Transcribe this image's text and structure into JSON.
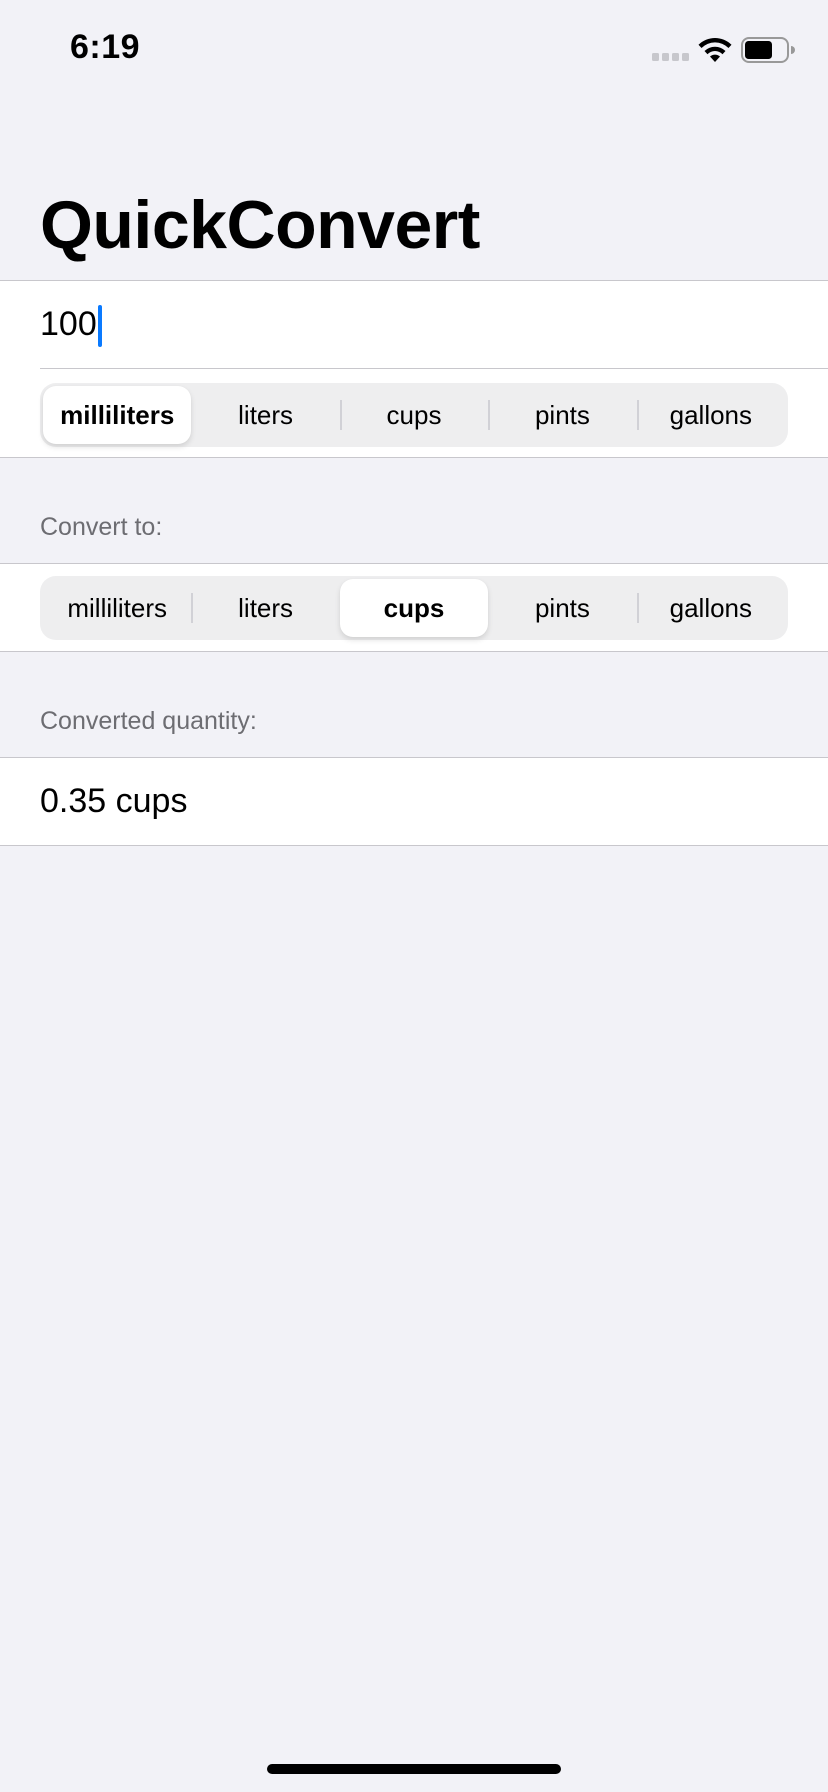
{
  "status_bar": {
    "time": "6:19",
    "icons": [
      "signal-icon",
      "wifi-icon",
      "battery-icon"
    ]
  },
  "app": {
    "title": "QuickConvert"
  },
  "input": {
    "amount": "100"
  },
  "from_units": {
    "options": [
      "milliliters",
      "liters",
      "cups",
      "pints",
      "gallons"
    ],
    "selected": "milliliters"
  },
  "convert_to": {
    "header": "Convert to:",
    "options": [
      "milliliters",
      "liters",
      "cups",
      "pints",
      "gallons"
    ],
    "selected": "cups"
  },
  "result": {
    "header": "Converted quantity:",
    "value": "0.35 cups"
  },
  "colors": {
    "background": "#f2f2f7",
    "row_background": "#ffffff",
    "caret": "#0a7aff",
    "secondary_text": "#6d6d72"
  }
}
